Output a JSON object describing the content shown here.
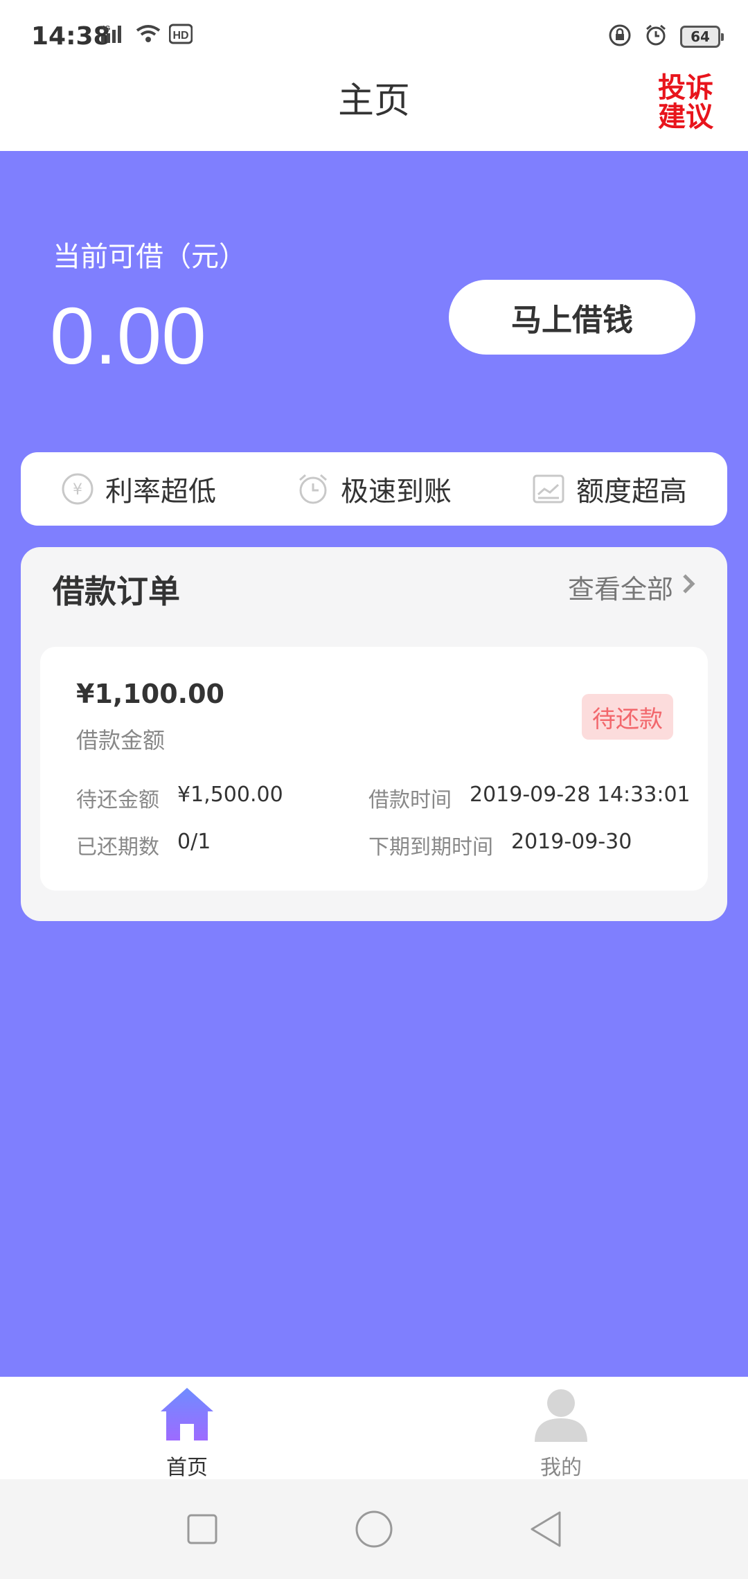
{
  "status_bar": {
    "time": "14:38",
    "network": "4G",
    "hd": "HD",
    "battery": "64"
  },
  "header": {
    "title": "主页",
    "complaint_label": "投诉建议"
  },
  "hero": {
    "available_label": "当前可借（元）",
    "available_amount": "0.00",
    "borrow_button": "马上借钱"
  },
  "features": [
    {
      "label": "利率超低",
      "icon": "yen-circle-icon"
    },
    {
      "label": "极速到账",
      "icon": "alarm-clock-icon"
    },
    {
      "label": "额度超高",
      "icon": "chart-icon"
    }
  ],
  "orders": {
    "section_title": "借款订单",
    "view_all": "查看全部",
    "items": [
      {
        "amount": "¥1,100.00",
        "amount_label": "借款金额",
        "status": "待还款",
        "due_label": "待还金额",
        "due_value": "¥1,500.00",
        "borrow_time_label": "借款时间",
        "borrow_time_value": "2019-09-28 14:33:01",
        "periods_label": "已还期数",
        "periods_value": "0/1",
        "next_due_label": "下期到期时间",
        "next_due_value": "2019-09-30"
      }
    ]
  },
  "bottom_nav": {
    "home": "首页",
    "mine": "我的"
  },
  "colors": {
    "primary": "#7f7ffe",
    "complaint_red": "#e8141c",
    "status_badge_bg": "#fcdcdc",
    "status_badge_text": "#f2676c"
  }
}
